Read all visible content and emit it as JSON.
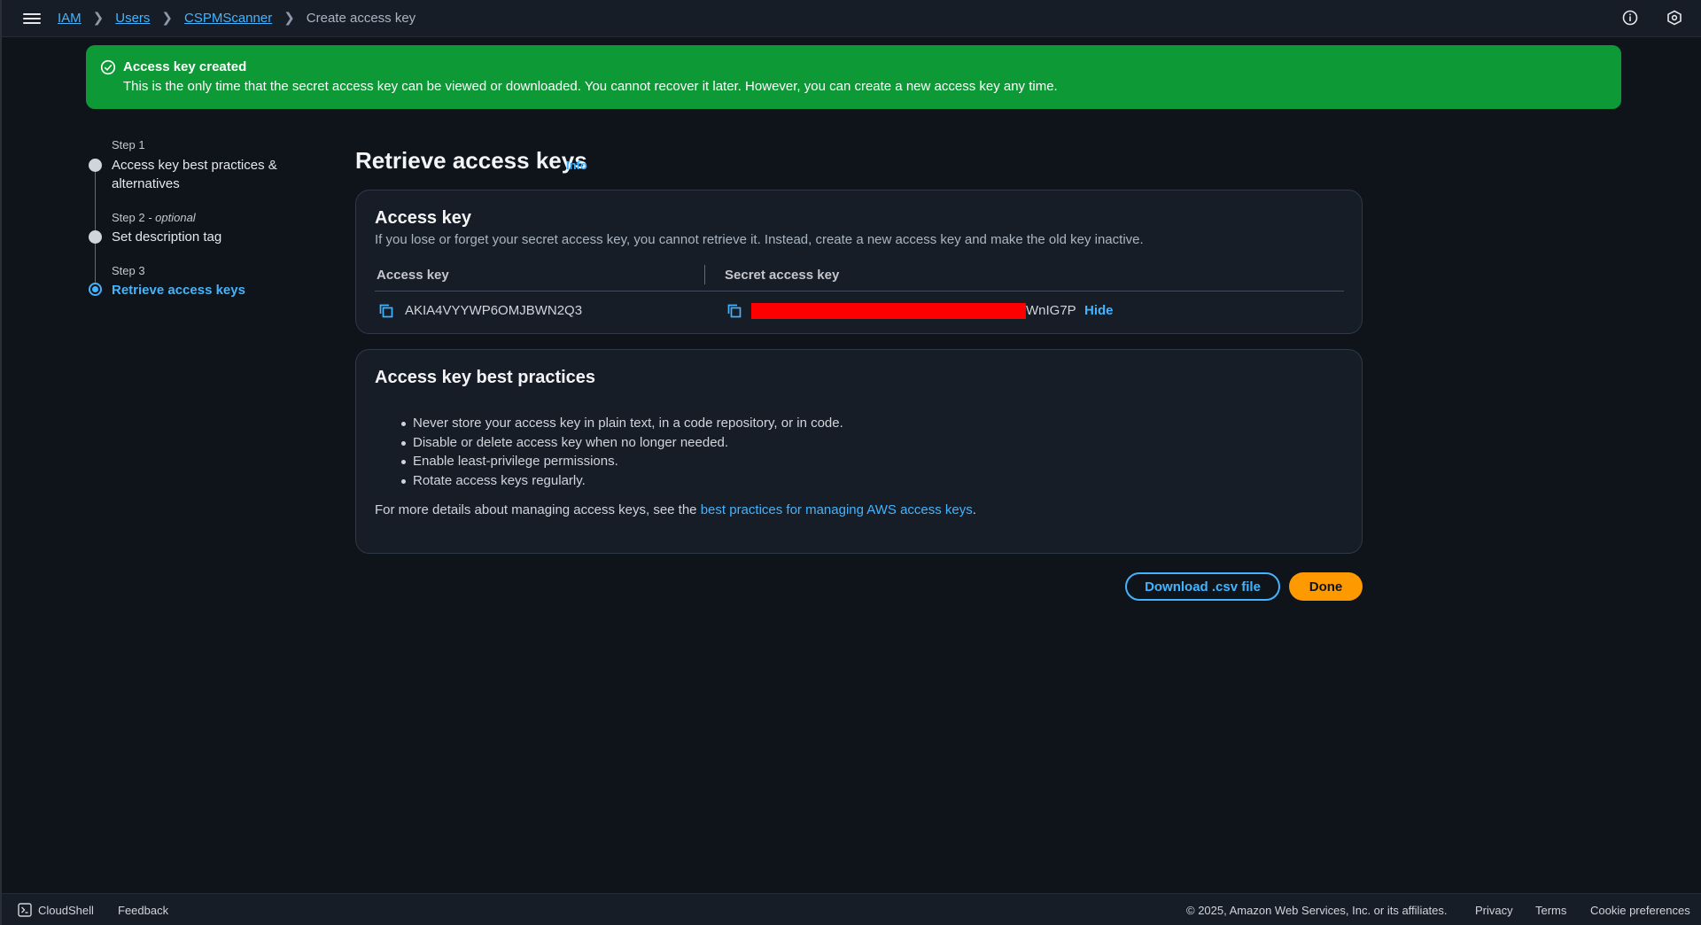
{
  "breadcrumb": {
    "items": [
      "IAM",
      "Users",
      "CSPMScanner"
    ],
    "current": "Create access key"
  },
  "flash": {
    "title": "Access key created",
    "message": "This is the only time that the secret access key can be viewed or downloaded. You cannot recover it later. However, you can create a new access key any time."
  },
  "steps": [
    {
      "label": "Step 1",
      "title": "Access key best practices & alternatives"
    },
    {
      "label": "Step 2",
      "optional": "- optional",
      "title": "Set description tag"
    },
    {
      "label": "Step 3",
      "title": "Retrieve access keys"
    }
  ],
  "main": {
    "title": "Retrieve access keys",
    "info": "Info"
  },
  "access_key_card": {
    "title": "Access key",
    "description": "If you lose or forget your secret access key, you cannot retrieve it. Instead, create a new access key and make the old key inactive.",
    "columns": [
      "Access key",
      "Secret access key"
    ],
    "access_key_value": "AKIA4VYYWP6OMJBWN2Q3",
    "secret_suffix": "WnIG7P",
    "hide_label": "Hide"
  },
  "best_practices": {
    "title": "Access key best practices",
    "items": [
      "Never store your access key in plain text, in a code repository, or in code.",
      "Disable or delete access key when no longer needed.",
      "Enable least-privilege permissions.",
      "Rotate access keys regularly."
    ],
    "more_prefix": "For more details about managing access keys, see the ",
    "more_link": "best practices for managing AWS access keys",
    "more_suffix": "."
  },
  "buttons": {
    "download": "Download .csv file",
    "done": "Done"
  },
  "footer": {
    "cloudshell": "CloudShell",
    "feedback": "Feedback",
    "copyright": "© 2025, Amazon Web Services, Inc. or its affiliates.",
    "privacy": "Privacy",
    "terms": "Terms",
    "cookies": "Cookie preferences"
  },
  "colors": {
    "accent": "#42b4ff",
    "success": "#0d9a36",
    "primary_button": "#ff9900",
    "redaction": "#ff0000"
  }
}
